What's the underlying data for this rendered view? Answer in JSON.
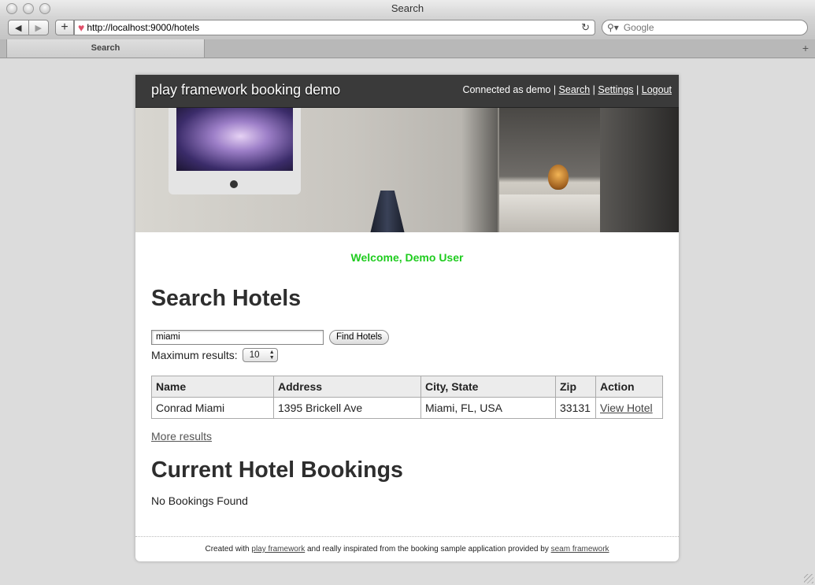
{
  "window": {
    "title": "Search"
  },
  "browser": {
    "url": "http://localhost:9000/hotels",
    "search_placeholder": "Google",
    "tab_label": "Search"
  },
  "page": {
    "brand": "play framework booking demo",
    "usernav": {
      "connected_text": "Connected as demo",
      "sep": "|",
      "search": "Search",
      "settings": "Settings",
      "logout": "Logout"
    },
    "welcome": "Welcome, Demo User",
    "search_heading": "Search Hotels",
    "search_value": "miami",
    "find_button": "Find Hotels",
    "max_results_label": "Maximum results:",
    "max_results_value": "10",
    "table": {
      "headers": [
        "Name",
        "Address",
        "City, State",
        "Zip",
        "Action"
      ],
      "rows": [
        {
          "name": "Conrad Miami",
          "address": "1395 Brickell Ave",
          "city_state": "Miami, FL, USA",
          "zip": "33131",
          "action": "View Hotel"
        }
      ]
    },
    "more_results": "More results",
    "bookings_heading": "Current Hotel Bookings",
    "no_bookings": "No Bookings Found",
    "footer": {
      "prefix": "Created with",
      "link1": "play framework",
      "middle": "and really inspirated from the booking sample application provided by",
      "link2": "seam framework"
    }
  },
  "colors": {
    "welcome": "#1fcc1f",
    "header_bg": "#3a3a3a"
  }
}
